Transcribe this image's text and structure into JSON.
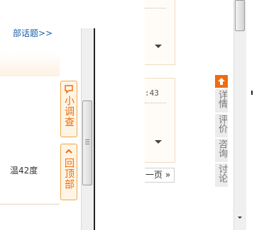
{
  "left": {
    "topic_link": "部话题>>",
    "temperature_text": "温42度",
    "survey_tab": "小调查",
    "backtop_tab": "回顶部",
    "survey_icon": "chat-bubble-icon",
    "backtop_icon": "chevron-up-icon"
  },
  "right": {
    "time_text": ":43",
    "next_page": "一页 »",
    "nav_up_icon": "arrow-up-icon",
    "nav_items": [
      {
        "label": "详情"
      },
      {
        "label": "评价"
      },
      {
        "label": "咨询"
      },
      {
        "label": "讨论"
      }
    ]
  },
  "colors": {
    "accent_orange": "#f06b10",
    "tab_border": "#f3a64a",
    "link_blue": "#1a5ea8"
  }
}
